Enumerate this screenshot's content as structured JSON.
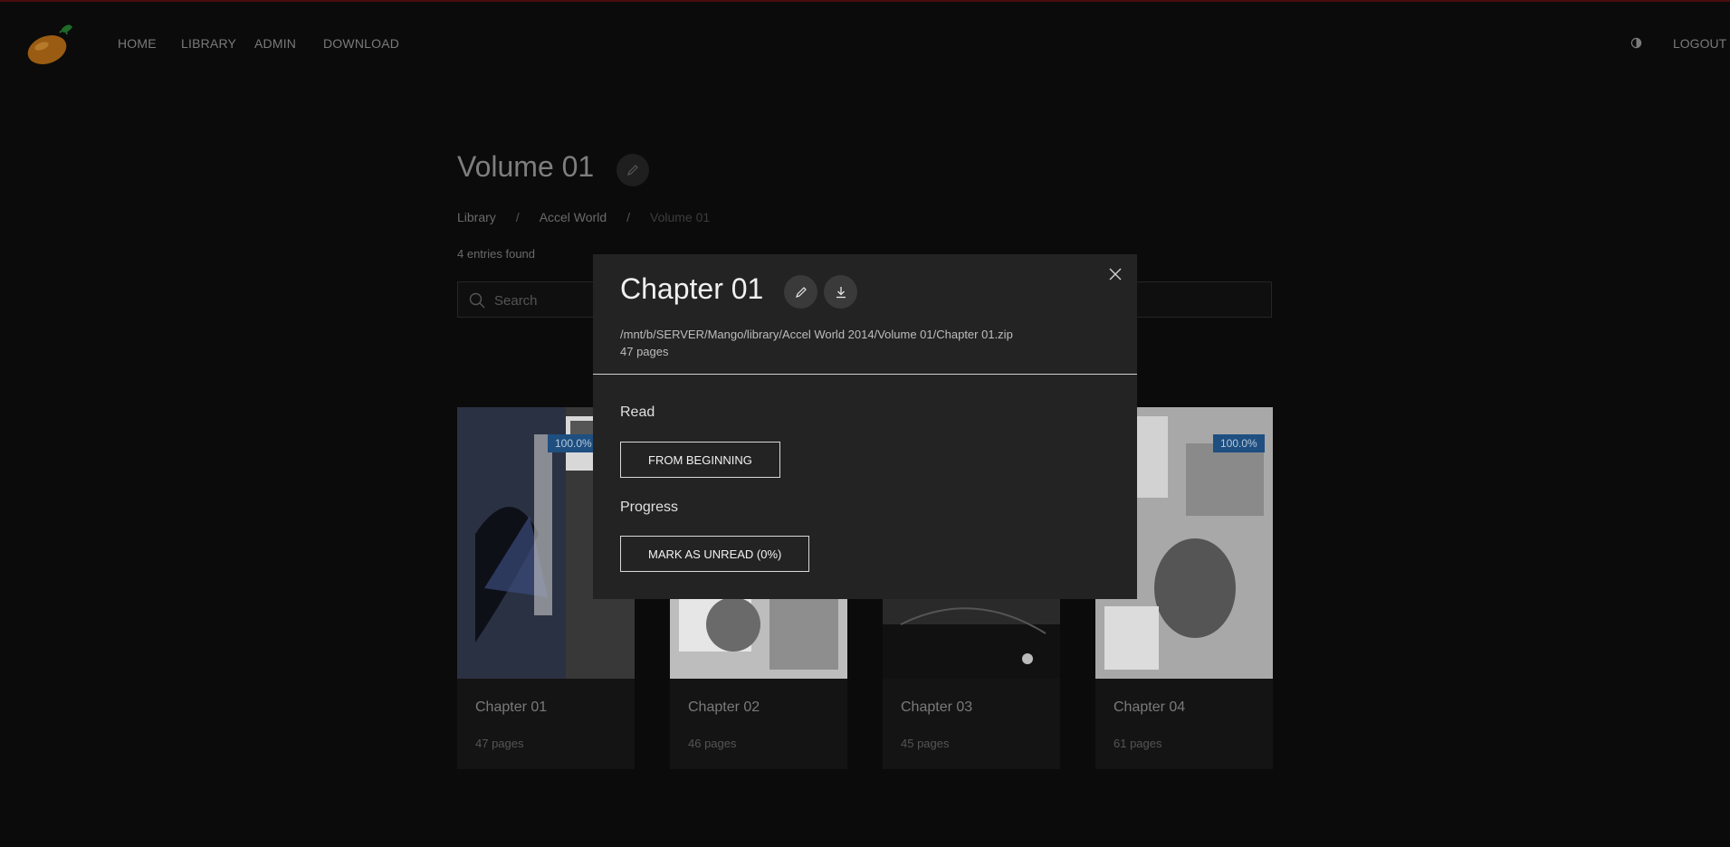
{
  "nav": {
    "links": [
      "HOME",
      "LIBRARY",
      "ADMIN",
      "DOWNLOAD"
    ],
    "logout": "LOGOUT",
    "theme_icon": "contrast-icon",
    "logo_icon": "mango-logo"
  },
  "page": {
    "title": "Volume 01",
    "breadcrumb": [
      "Library",
      "Accel World",
      "Volume 01"
    ],
    "breadcrumb_sep": "/",
    "entries_found": "4 entries found",
    "search_placeholder": "Search"
  },
  "cards": [
    {
      "title": "Chapter 01",
      "pages": "47 pages",
      "progress": "100.0%"
    },
    {
      "title": "Chapter 02",
      "pages": "46 pages",
      "progress": ""
    },
    {
      "title": "Chapter 03",
      "pages": "45 pages",
      "progress": ""
    },
    {
      "title": "Chapter 04",
      "pages": "61 pages",
      "progress": "100.0%"
    }
  ],
  "modal": {
    "title": "Chapter 01",
    "path": "/mnt/b/SERVER/Mango/library/Accel World 2014/Volume 01/Chapter 01.zip",
    "pages": "47 pages",
    "read_label": "Read",
    "from_beginning": "FROM BEGINNING",
    "progress_label": "Progress",
    "mark_unread": "MARK AS UNREAD (0%)"
  },
  "colors": {
    "accent_badge": "#1e4f80",
    "modal_bg": "#232323",
    "page_bg": "#0b0b0b",
    "top_border": "#4a0d0d"
  }
}
